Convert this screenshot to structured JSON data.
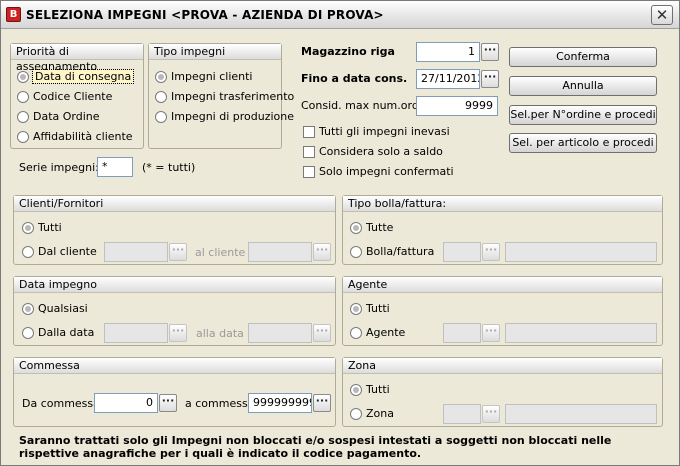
{
  "window": {
    "title": "SELEZIONA IMPEGNI <PROVA - AZIENDA DI PROVA>",
    "icon_letter": "B",
    "close_glyph": "✕"
  },
  "priority": {
    "title": "Priorità di assegnamento",
    "options": [
      "Data di consegna",
      "Codice Cliente",
      "Data Ordine",
      "Affidabilità cliente"
    ],
    "selected": "Data di consegna"
  },
  "tipo_impegni": {
    "title": "Tipo impegni",
    "options": [
      "Impegni clienti",
      "Impegni trasferimento",
      "Impegni di produzione"
    ],
    "selected": "Impegni clienti"
  },
  "fields": {
    "magazzino_label": "Magazzino riga",
    "magazzino_value": "1",
    "fino_data_label": "Fino a data cons.",
    "fino_data_value": "27/11/2012",
    "consid_label": "Consid. max num.ord.:",
    "consid_value": "9999",
    "dots_glyph": "···"
  },
  "checkboxes": {
    "tutti": "Tutti gli impegni inevasi",
    "saldo": "Considera solo a saldo",
    "confermati": "Solo impegni confermati"
  },
  "buttons": {
    "conferma": "Conferma",
    "annulla": "Annulla",
    "sel_ordine": "Sel.per N°ordine e procedi",
    "sel_articolo": "Sel. per articolo e procedi"
  },
  "serie": {
    "label": "Serie impegni:",
    "value": "*",
    "hint": "(* = tutti)"
  },
  "clienti": {
    "title": "Clienti/Fornitori",
    "opt_all": "Tutti",
    "opt_from": "Dal cliente",
    "to_label": "al cliente"
  },
  "bolla": {
    "title": "Tipo bolla/fattura:",
    "opt_all": "Tutte",
    "opt_sel": "Bolla/fattura"
  },
  "data_impegno": {
    "title": "Data impegno",
    "opt_all": "Qualsiasi",
    "opt_from": "Dalla data",
    "to_label": "alla data"
  },
  "agente": {
    "title": "Agente",
    "opt_all": "Tutti",
    "opt_sel": "Agente"
  },
  "commessa": {
    "title": "Commessa",
    "from_label": "Da commessa",
    "from_value": "0",
    "to_label": "a commessa",
    "to_value": "999999999"
  },
  "zona": {
    "title": "Zona",
    "opt_all": "Tutti",
    "opt_sel": "Zona"
  },
  "footer": "Saranno trattati solo gli Impegni non bloccati e/o sospesi intestati a soggetti non bloccati nelle rispettive anagrafiche per i quali è indicato il codice pagamento."
}
